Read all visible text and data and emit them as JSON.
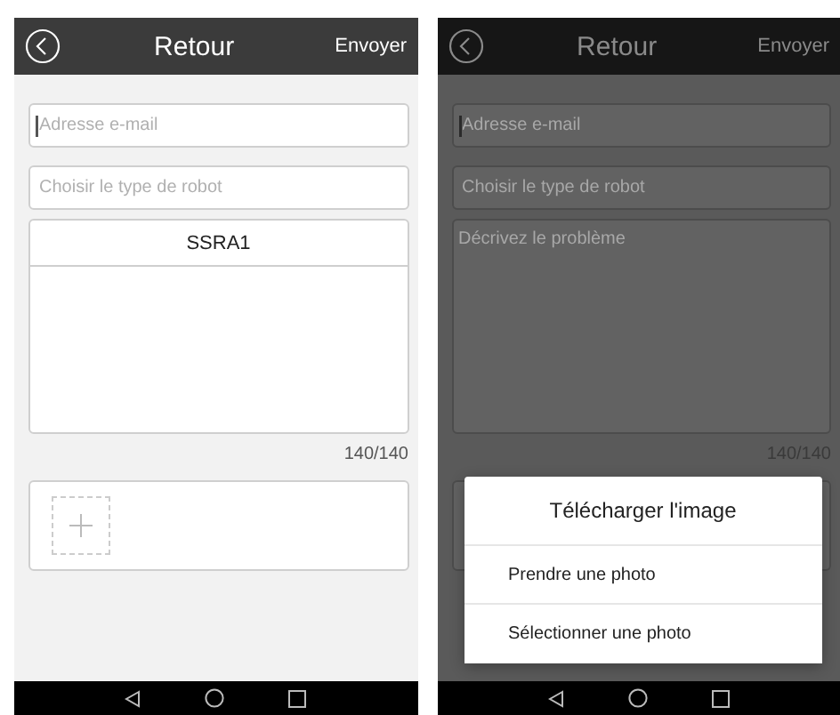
{
  "screens": [
    {
      "dimmed": false,
      "header": {
        "title": "Retour",
        "action": "Envoyer"
      },
      "email": {
        "placeholder": "Adresse e-mail",
        "focused": true
      },
      "robot_type": {
        "placeholder": "Choisir le type de robot"
      },
      "robot_options": [
        "SSRA1"
      ],
      "counter": "140/140",
      "add_photo_tile": true
    },
    {
      "dimmed": true,
      "header": {
        "title": "Retour",
        "action": "Envoyer"
      },
      "email": {
        "placeholder": "Adresse e-mail",
        "focused": true
      },
      "robot_type": {
        "placeholder": "Choisir le type de robot"
      },
      "description": {
        "placeholder": "Décrivez le problème"
      },
      "counter": "140/140",
      "dialog": {
        "title": "Télécharger l'image",
        "options": [
          "Prendre une photo",
          "Sélectionner une photo"
        ]
      }
    }
  ]
}
